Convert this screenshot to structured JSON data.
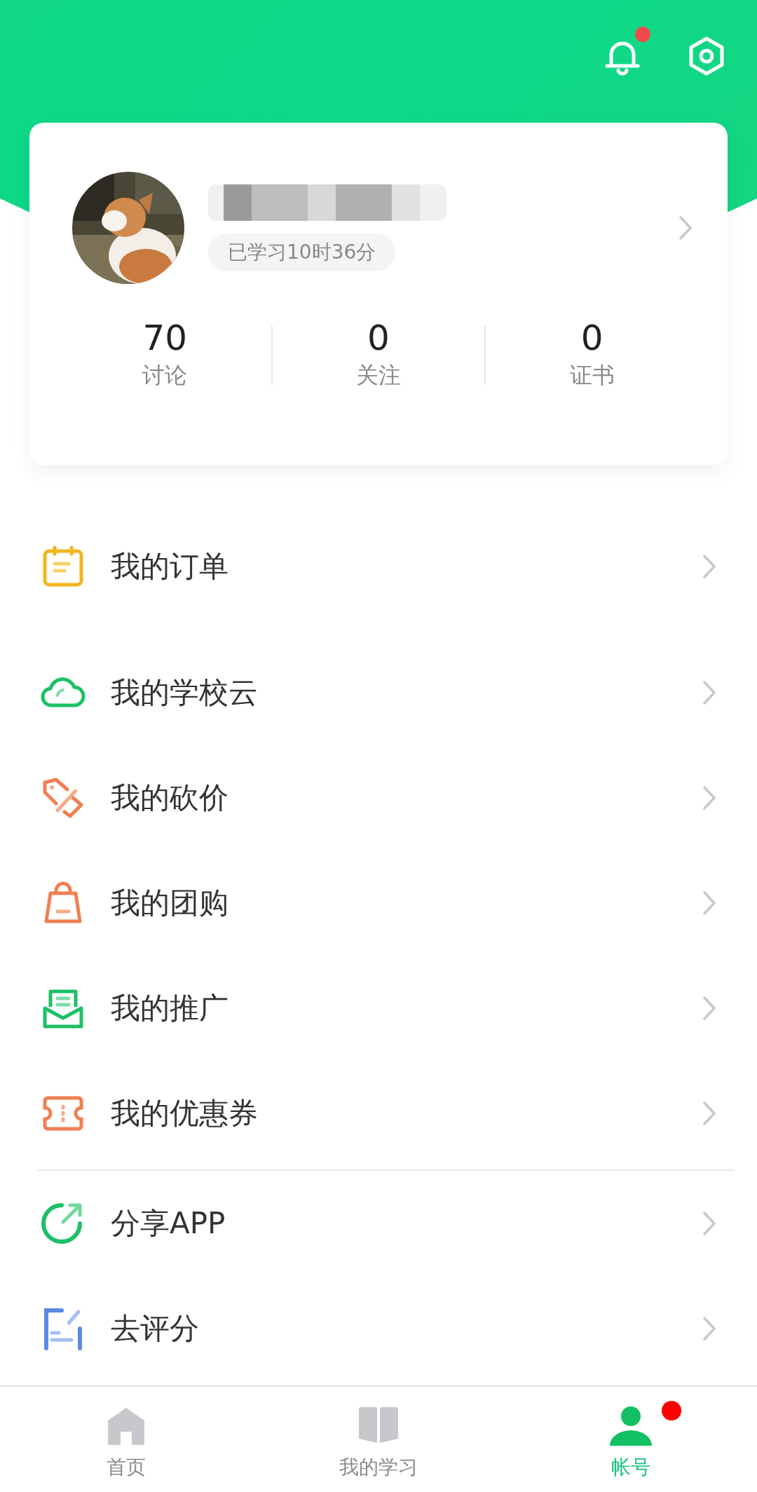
{
  "header": {
    "notification_badge": true
  },
  "profile": {
    "study_time": "已学习10时36分",
    "stats": [
      {
        "value": "70",
        "label": "讨论"
      },
      {
        "value": "0",
        "label": "关注"
      },
      {
        "value": "0",
        "label": "证书"
      }
    ]
  },
  "menu_sections": [
    [
      {
        "label": "我的订单",
        "kind": "order"
      }
    ],
    [
      {
        "label": "我的学校云",
        "kind": "cloud"
      },
      {
        "label": "我的砍价",
        "kind": "bargain"
      },
      {
        "label": "我的团购",
        "kind": "group-buy"
      },
      {
        "label": "我的推广",
        "kind": "promotion"
      },
      {
        "label": "我的优惠券",
        "kind": "coupon"
      }
    ],
    [
      {
        "label": "分享APP",
        "kind": "share"
      },
      {
        "label": "去评分",
        "kind": "rate"
      }
    ]
  ],
  "tab_bar": [
    {
      "label": "首页",
      "kind": "home",
      "selected": false,
      "badge": false
    },
    {
      "label": "我的学习",
      "kind": "study",
      "selected": false,
      "badge": false
    },
    {
      "label": "帐号",
      "kind": "account",
      "selected": true,
      "badge": true
    }
  ]
}
